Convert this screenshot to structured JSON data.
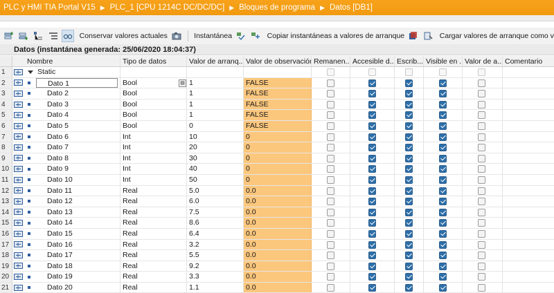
{
  "breadcrumb": [
    "PLC y HMI TIA Portal V15",
    "PLC_1 [CPU 1214C DC/DC/DC]",
    "Bloques de programa",
    "Datos [DB1]"
  ],
  "toolbar": {
    "keep_values": "Conservar valores actuales",
    "snapshot": "Instantánea",
    "copy_snapshots": "Copiar instantáneas a valores de arranque",
    "load_start_values": "Cargar valores de arranque como v"
  },
  "block_header": "Datos (instantánea generada: 25/06/2020 18:04:37)",
  "columns": {
    "name": "Nombre",
    "type": "Tipo de datos",
    "start": "Valor de arranq...",
    "observation": "Valor de observación",
    "retain": "Remanen...",
    "accessible": "Accesible d...",
    "writable": "Escrib...",
    "visible": "Visible en ...",
    "setpoint": "Valor de a...",
    "comment": "Comentario"
  },
  "static_row": {
    "num": "1",
    "name": "Static"
  },
  "rows": [
    {
      "num": "2",
      "name": "Dato 1",
      "type": "Bool",
      "start": "1",
      "obs": "FALSE"
    },
    {
      "num": "3",
      "name": "Dato 2",
      "type": "Bool",
      "start": "1",
      "obs": "FALSE"
    },
    {
      "num": "4",
      "name": "Dato 3",
      "type": "Bool",
      "start": "1",
      "obs": "FALSE"
    },
    {
      "num": "5",
      "name": "Dato 4",
      "type": "Bool",
      "start": "1",
      "obs": "FALSE"
    },
    {
      "num": "6",
      "name": "Dato 5",
      "type": "Bool",
      "start": "0",
      "obs": "FALSE"
    },
    {
      "num": "7",
      "name": "Dato 6",
      "type": "Int",
      "start": "10",
      "obs": "0"
    },
    {
      "num": "8",
      "name": "Dato 7",
      "type": "Int",
      "start": "20",
      "obs": "0"
    },
    {
      "num": "9",
      "name": "Dato 8",
      "type": "Int",
      "start": "30",
      "obs": "0"
    },
    {
      "num": "10",
      "name": "Dato 9",
      "type": "Int",
      "start": "40",
      "obs": "0"
    },
    {
      "num": "11",
      "name": "Dato 10",
      "type": "Int",
      "start": "50",
      "obs": "0"
    },
    {
      "num": "12",
      "name": "Dato 11",
      "type": "Real",
      "start": "5.0",
      "obs": "0.0"
    },
    {
      "num": "13",
      "name": "Dato 12",
      "type": "Real",
      "start": "6.0",
      "obs": "0.0"
    },
    {
      "num": "14",
      "name": "Dato 13",
      "type": "Real",
      "start": "7.5",
      "obs": "0.0"
    },
    {
      "num": "15",
      "name": "Dato 14",
      "type": "Real",
      "start": "8.6",
      "obs": "0.0"
    },
    {
      "num": "16",
      "name": "Dato 15",
      "type": "Real",
      "start": "6.4",
      "obs": "0.0"
    },
    {
      "num": "17",
      "name": "Dato 16",
      "type": "Real",
      "start": "3.2",
      "obs": "0.0"
    },
    {
      "num": "18",
      "name": "Dato 17",
      "type": "Real",
      "start": "5.5",
      "obs": "0.0"
    },
    {
      "num": "19",
      "name": "Dato 18",
      "type": "Real",
      "start": "9.2",
      "obs": "0.0"
    },
    {
      "num": "20",
      "name": "Dato 19",
      "type": "Real",
      "start": "3.3",
      "obs": "0.0"
    },
    {
      "num": "21",
      "name": "Dato 20",
      "type": "Real",
      "start": "1.1",
      "obs": "0.0"
    }
  ],
  "colors": {
    "titlebar": "#f29a10",
    "observation_bg": "#fbc77d",
    "checkbox_on": "#2e6fa8"
  }
}
